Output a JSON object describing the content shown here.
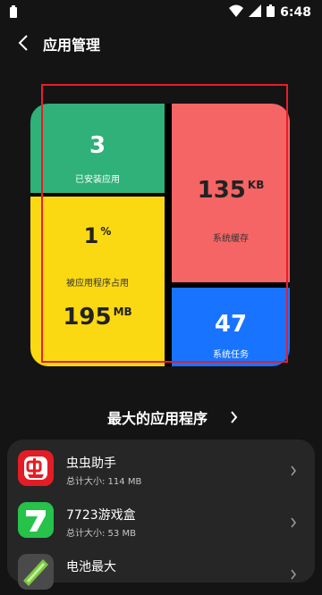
{
  "status_bar": {
    "time": "6:48"
  },
  "header": {
    "title": "应用管理"
  },
  "storage": {
    "installed": {
      "value": "3",
      "label": "已安装应用"
    },
    "usage": {
      "value": "1",
      "unit": "%",
      "label": "被应用程序占用",
      "size": "195",
      "size_unit": "MB"
    },
    "cache": {
      "value": "135",
      "unit": "KB",
      "label": "系统缓存"
    },
    "tasks": {
      "value": "47",
      "label": "系统任务"
    }
  },
  "largest_apps": {
    "title": "最大的应用程序",
    "items": [
      {
        "name": "虫虫助手",
        "size": "总计大小: 114 MB",
        "icon": "chongchong-app-icon"
      },
      {
        "name": "7723游戏盒",
        "size": "总计大小: 53 MB",
        "icon": "7723-app-icon"
      },
      {
        "name": "电池最大",
        "size": "",
        "icon": "battery-app-icon"
      }
    ]
  },
  "colors": {
    "green": "#2fb179",
    "yellow": "#fbd912",
    "red": "#f56565",
    "blue": "#1874ff",
    "highlight": "#e81e2a"
  }
}
